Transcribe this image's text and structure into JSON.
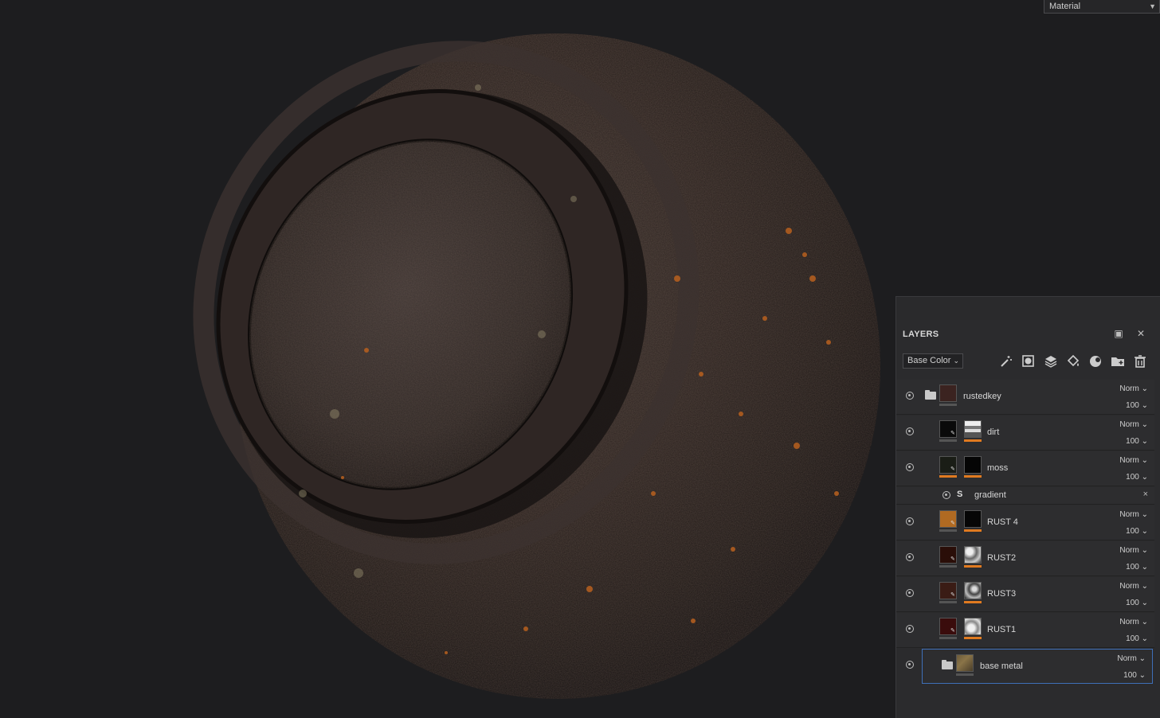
{
  "viewport": {
    "channel_select": "Material"
  },
  "layers_panel": {
    "title": "LAYERS",
    "channel_dropdown": "Base Color",
    "accent_color": "#e07a20",
    "toolbar_icons": [
      "magic-wand-icon",
      "add-mask-icon",
      "add-layer-icon",
      "add-fill-layer-icon",
      "add-filter-icon",
      "add-folder-icon",
      "delete-icon"
    ],
    "layers": [
      {
        "name": "rustedkey",
        "type": "folder",
        "blend": "Norm",
        "opacity": "100",
        "thumb": "#3b2320",
        "mask": null
      },
      {
        "name": "dirt",
        "type": "layer",
        "blend": "Norm",
        "opacity": "100",
        "thumb": "#0a0a0a",
        "mask": "#bdbdbd"
      },
      {
        "name": "moss",
        "type": "layer",
        "blend": "Norm",
        "opacity": "100",
        "thumb": "#1a1d16",
        "mask": "#050505"
      },
      {
        "name": "RUST 4",
        "type": "layer",
        "blend": "Norm",
        "opacity": "100",
        "thumb": "#b06a22",
        "mask": "#060606"
      },
      {
        "name": "RUST2",
        "type": "layer",
        "blend": "Norm",
        "opacity": "100",
        "thumb": "#2a0e08",
        "mask": "#aaaaaa"
      },
      {
        "name": "RUST3",
        "type": "layer",
        "blend": "Norm",
        "opacity": "100",
        "thumb": "#3a1c15",
        "mask": "#999999"
      },
      {
        "name": "RUST1",
        "type": "layer",
        "blend": "Norm",
        "opacity": "100",
        "thumb": "#3a0c0c",
        "mask": "#cccccc"
      },
      {
        "name": "base metal",
        "type": "folder",
        "blend": "Norm",
        "opacity": "100",
        "thumb": "#6b5a3a",
        "mask": null
      }
    ],
    "effect": {
      "name": "gradient",
      "close": "×"
    }
  }
}
